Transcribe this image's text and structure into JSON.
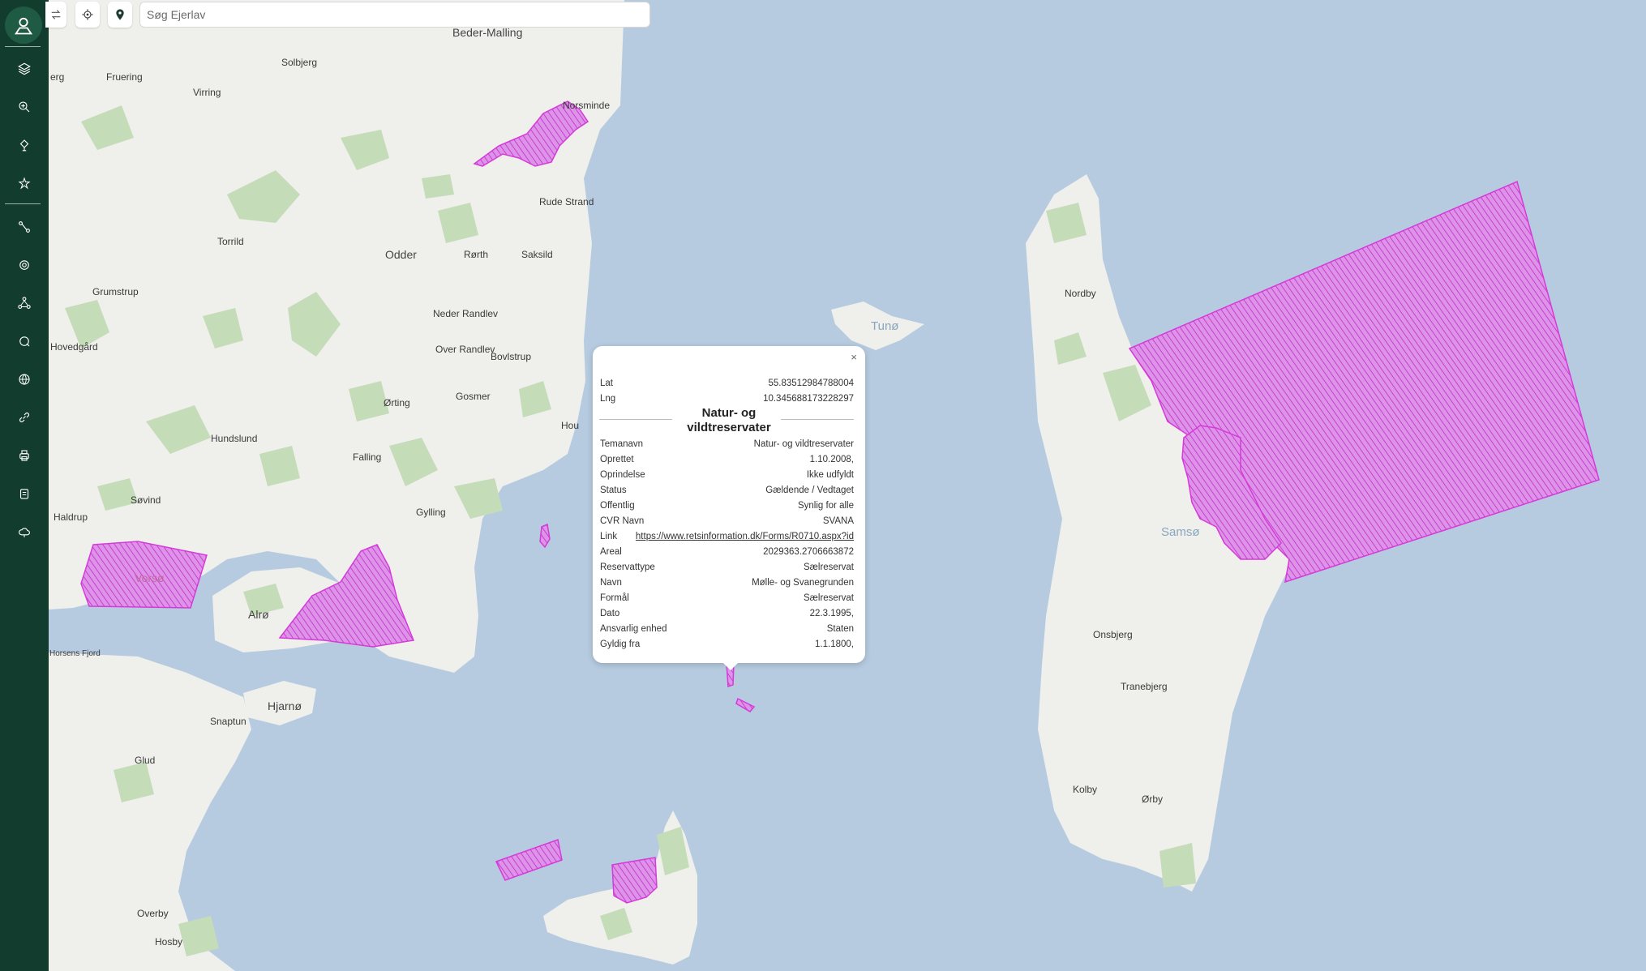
{
  "search": {
    "placeholder": "Søg Ejerlav"
  },
  "sidebar": {
    "items": [
      {
        "icon": "profile-map-icon"
      },
      {
        "icon": "layers-icon"
      },
      {
        "icon": "zoom-search-icon"
      },
      {
        "icon": "drone-icon"
      },
      {
        "icon": "star-list-icon"
      },
      {
        "icon": "route-icon"
      },
      {
        "icon": "target-icon"
      },
      {
        "icon": "network-icon"
      },
      {
        "icon": "location-search-icon"
      },
      {
        "icon": "globe-icon"
      },
      {
        "icon": "link-icon"
      },
      {
        "icon": "printer-icon"
      },
      {
        "icon": "clipboard-icon"
      },
      {
        "icon": "cloud-icon"
      }
    ]
  },
  "toolbar": {
    "collapse_icon": "collapse-arrows-icon",
    "locate_icon": "crosshair-icon",
    "pin_icon": "map-pin-icon"
  },
  "map_labels": {
    "beder_malling": "Beder-Malling",
    "solbjerg": "Solbjerg",
    "fruering": "Fruering",
    "virring": "Virring",
    "norsminde": "Norsminde",
    "rude_strand": "Rude Strand",
    "torrild": "Torrild",
    "odder": "Odder",
    "rorth": "Rørth",
    "saksild": "Saksild",
    "grumstrup": "Grumstrup",
    "neder_randlev": "Neder Randlev",
    "over_randlev": "Over Randlev",
    "bovlstrup": "Bovlstrup",
    "hovedgaard": "Hovedgård",
    "orting": "Ørting",
    "gosmer": "Gosmer",
    "hou": "Hou",
    "hundslund": "Hundslund",
    "falling": "Falling",
    "sovind": "Søvind",
    "gylling": "Gylling",
    "haldrup": "Haldrup",
    "vorso": "Vorsø",
    "alro": "Alrø",
    "horsens_fjord": "Horsens Fjord",
    "hjarno": "Hjarnø",
    "snaptun": "Snaptun",
    "glud": "Glud",
    "overby": "Overby",
    "hosby": "Hosby",
    "tuno": "Tunø",
    "nordby": "Nordby",
    "samso": "Samsø",
    "onsbjerg": "Onsbjerg",
    "tranebjerg": "Tranebjerg",
    "kolby": "Kolby",
    "orby": "Ørby",
    "erg": "erg"
  },
  "colors": {
    "sea": "#b6cbe0",
    "land": "#efefec",
    "forest": "#c5dcb8",
    "reserve": "#d357d6",
    "sidebar": "#123c2d",
    "link": "#2f8f8a"
  },
  "popup": {
    "close_label": "×",
    "lat_label": "Lat",
    "lat_value": "55.83512984788004",
    "lng_label": "Lng",
    "lng_value": "10.345688173228297",
    "title_line1": "Natur- og",
    "title_line2": "vildtreservater",
    "rows": [
      {
        "k": "Temanavn",
        "v": "Natur- og vildtreservater"
      },
      {
        "k": "Oprettet",
        "v": "1.10.2008,"
      },
      {
        "k": "Oprindelse",
        "v": "Ikke udfyldt"
      },
      {
        "k": "Status",
        "v": "Gældende / Vedtaget"
      },
      {
        "k": "Offentlig",
        "v": "Synlig for alle"
      },
      {
        "k": "CVR Navn",
        "v": "SVANA"
      },
      {
        "k": "Link",
        "v": "https://www.retsinformation.dk/Forms/R0710.aspx?id"
      },
      {
        "k": "Areal",
        "v": "2029363.2706663872"
      },
      {
        "k": "Reservattype",
        "v": "Sælreservat"
      },
      {
        "k": "Navn",
        "v": "Mølle- og Svanegrunden"
      },
      {
        "k": "Formål",
        "v": "Sælreservat"
      },
      {
        "k": "Dato",
        "v": "22.3.1995,"
      },
      {
        "k": "Ansvarlig enhed",
        "v": "Staten"
      },
      {
        "k": "Gyldig fra",
        "v": "1.1.1800,"
      }
    ]
  }
}
